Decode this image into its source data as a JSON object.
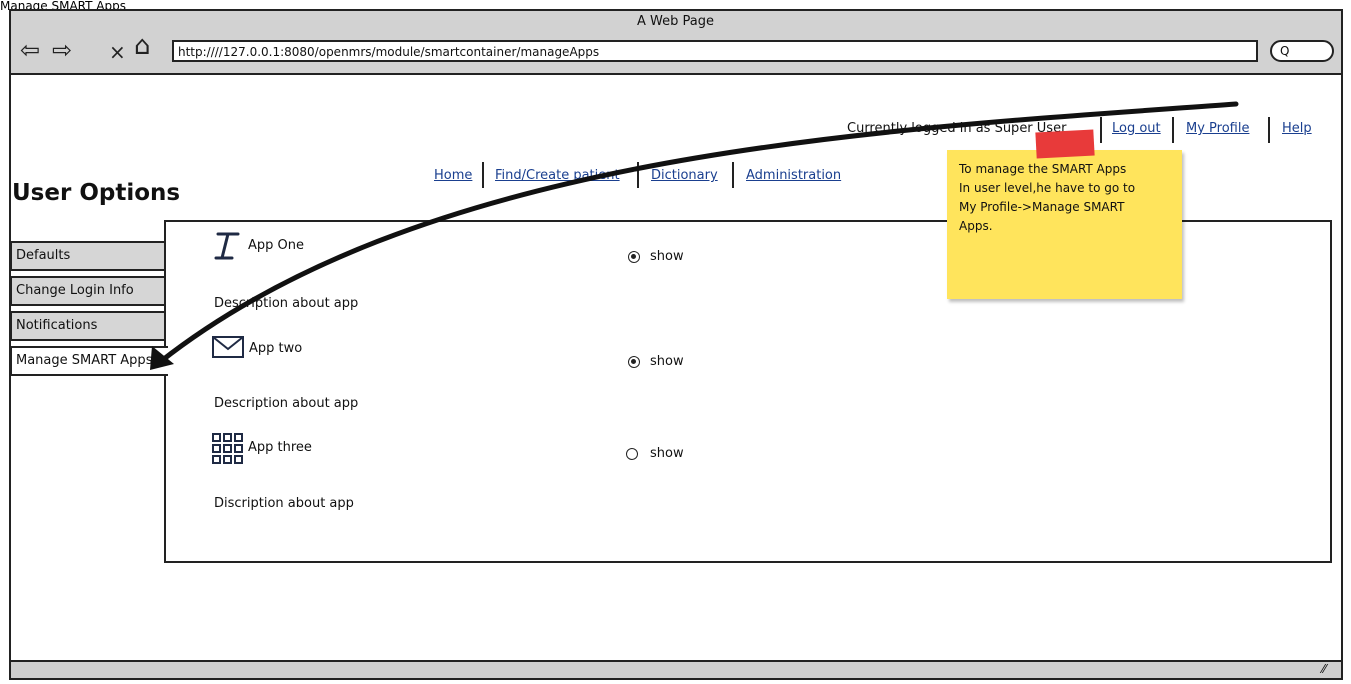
{
  "window": {
    "caption": "Manage SMART Apps",
    "title": "A Web Page",
    "url": "http:////127.0.0.1:8080/openmrs/module/smartcontainer/manageApps",
    "search_glyph": "Q"
  },
  "icons": {
    "back": "⇦",
    "forward": "⇨",
    "close": "×",
    "home": "⌂",
    "resize": "⁄⁄"
  },
  "topbar": {
    "status": "Currently logged in as Super User",
    "logout": "Log out",
    "profile": "My Profile",
    "help": "Help"
  },
  "nav": {
    "home": "Home",
    "patient": "Find/Create patient",
    "dictionary": "Dictionary",
    "administration": "Administration"
  },
  "page": {
    "title": "User Options"
  },
  "sidebar": {
    "items": [
      {
        "label": "Defaults"
      },
      {
        "label": "Change Login Info"
      },
      {
        "label": "Notifications"
      },
      {
        "label": "Manage SMART Apps"
      }
    ],
    "active_index": 3
  },
  "apps": [
    {
      "name": "App One",
      "icon": "text-cursor-icon",
      "description": "Description about app",
      "option": "show",
      "selected": true
    },
    {
      "name": "App two",
      "icon": "envelope-icon",
      "description": "Description about app",
      "option": "show",
      "selected": true
    },
    {
      "name": "App three",
      "icon": "grid-icon",
      "description": "Discription about app",
      "option": "show",
      "selected": false
    }
  ],
  "note": {
    "lines": [
      "To manage the SMART Apps",
      "In user level,he have to go to",
      "My Profile->Manage SMART",
      "Apps."
    ],
    "colors": {
      "paper": "#ffe45c",
      "tape": "#e83a3a"
    }
  }
}
